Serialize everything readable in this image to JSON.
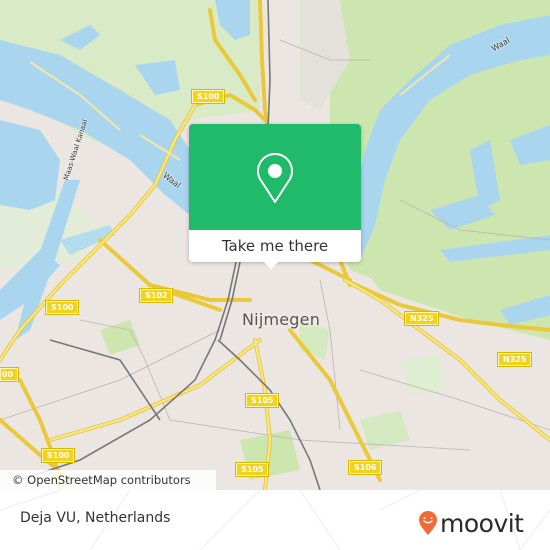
{
  "map": {
    "city_label": "Nijmegen",
    "road_shields": [
      {
        "id": "s100-north",
        "label": "S100"
      },
      {
        "id": "s100-west",
        "label": "S100"
      },
      {
        "id": "s100-edge",
        "label": "00"
      },
      {
        "id": "s100-south",
        "label": "S100"
      },
      {
        "id": "s102",
        "label": "S102"
      },
      {
        "id": "s105-center",
        "label": "S105"
      },
      {
        "id": "s105-south",
        "label": "S105"
      },
      {
        "id": "s106",
        "label": "S106"
      },
      {
        "id": "n325-west",
        "label": "N325"
      },
      {
        "id": "n325-east",
        "label": "N325"
      }
    ],
    "water_labels": [
      {
        "id": "waal-west",
        "label": "Waal"
      },
      {
        "id": "waal-east",
        "label": "Waal"
      },
      {
        "id": "maas-waal-kanaal",
        "label": "Maas-Waal Kanaal"
      }
    ],
    "attribution": "© OpenStreetMap contributors",
    "colors": {
      "land": "#ece6e3",
      "water": "#a9d6ee",
      "park": "#cde6b0",
      "road": "#f5de6a",
      "rail": "#777777"
    }
  },
  "popup": {
    "icon": "location-pin-icon",
    "button_label": "Take me there",
    "color": "#1fba6a"
  },
  "footer": {
    "place_name": "Deja VU, Netherlands",
    "logo_text": "moovit",
    "logo_icon": "moovit-smiley-pin-icon",
    "logo_color": "#f26a36"
  }
}
